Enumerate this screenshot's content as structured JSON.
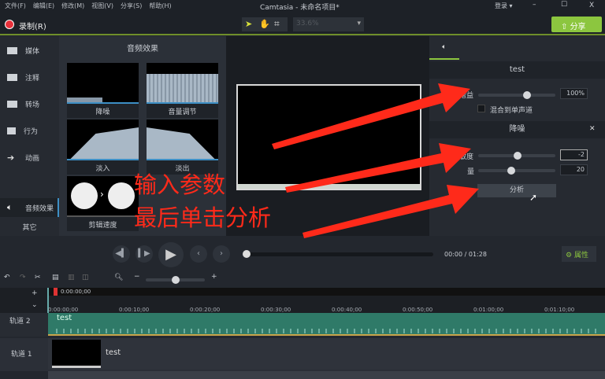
{
  "titlebar": {
    "menu": [
      "文件(F)",
      "编辑(E)",
      "修改(M)",
      "视图(V)",
      "分享(S)",
      "帮助(H)"
    ],
    "title": "Camtasia - 未命名项目*",
    "login": "登录 ▾",
    "minimize": "–",
    "maximize": "☐",
    "close": "X"
  },
  "toolbar": {
    "record": "录制(R)",
    "zoom_value": "33.6%",
    "share": "分享"
  },
  "sidebar": {
    "items": [
      "媒体",
      "注释",
      "转场",
      "行为",
      "动画",
      "音频效果"
    ],
    "other": "其它"
  },
  "effects": {
    "title": "音频效果",
    "items": [
      "降噪",
      "音量调节",
      "淡入",
      "淡出",
      "剪辑速度"
    ]
  },
  "annotation": {
    "line1": "输入参数",
    "line2": "最后单击分析"
  },
  "right": {
    "clip_name": "test",
    "gain_label": "增益",
    "gain_value": "100%",
    "gain_fraction": 0.75,
    "mix_mono": "混合到单声道",
    "noise_title": "降噪",
    "close": "✕",
    "sensitivity_label": "灵敏度",
    "sensitivity_value": "-2",
    "sensitivity_fraction": 0.5,
    "amount_label": "量",
    "amount_value": "20",
    "amount_fraction": 0.4,
    "analyze": "分析"
  },
  "playback": {
    "current": "00:00",
    "sep": "/",
    "total": "01:28",
    "properties": "属性"
  },
  "timeline": {
    "playhead": "0:00:00;00",
    "ticks": [
      "0:00:00;00",
      "0:00:10;00",
      "0:00:20;00",
      "0:00:30;00",
      "0:00:40;00",
      "0:00:50;00",
      "0:01:00;00",
      "0:01:10;00"
    ],
    "tracks": [
      {
        "name": "轨道 2",
        "clip": "test"
      },
      {
        "name": "轨道 1",
        "clip": "test"
      }
    ]
  },
  "colors": {
    "accent": "#8cc63f",
    "arrow": "#ff2a1a",
    "audio_clip": "#2f7a68"
  }
}
